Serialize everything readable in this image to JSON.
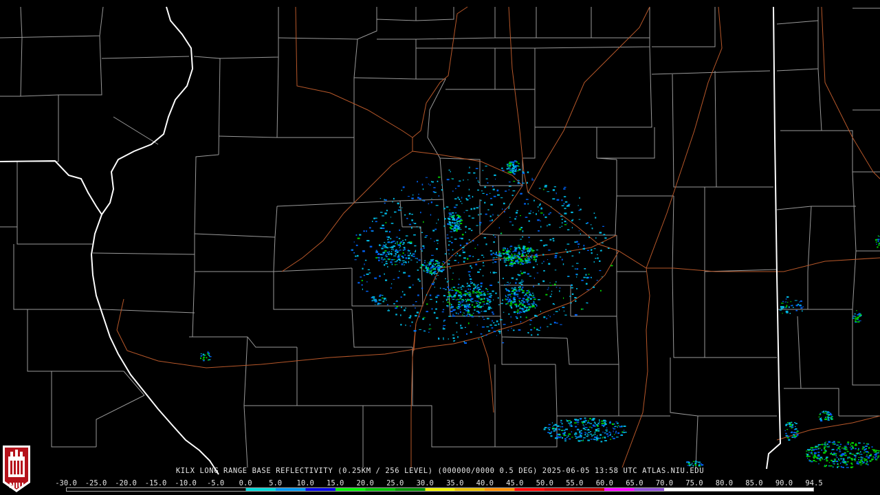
{
  "caption": "KILX LONG RANGE BASE REFLECTIVITY (0.25KM / 256 LEVEL) (000000/0000 0.5 DEG) 2025-06-05 13:58 UTC  ATLAS.NIU.EDU",
  "logo_text": "NIU",
  "scale": {
    "labels": [
      "-30.0",
      "-25.0",
      "-20.0",
      "-15.0",
      "-10.0",
      "-5.0",
      "0.0",
      "5.0",
      "10.0",
      "15.0",
      "20.0",
      "25.0",
      "30.0",
      "35.0",
      "40.0",
      "45.0",
      "50.0",
      "55.0",
      "60.0",
      "65.0",
      "70.0",
      "75.0",
      "80.0",
      "85.0",
      "90.0",
      "94.5"
    ],
    "colors": [
      "#000000",
      "#000000",
      "#000000",
      "#000000",
      "#000000",
      "#000000",
      "#00d8d8",
      "#0098f0",
      "#0000e8",
      "#00f000",
      "#00c000",
      "#009000",
      "#f0f000",
      "#e8c000",
      "#ff9000",
      "#ff0000",
      "#d80000",
      "#c00000",
      "#ff00ff",
      "#9050d8",
      "#ffffff",
      "#ffffff",
      "#ffffff",
      "#ffffff",
      "#ffffff"
    ]
  },
  "colors": {
    "county_border": "#9a9a9a",
    "state_border": "#ffffff",
    "highway": "#b8582a",
    "echo_light": "#00b8e0",
    "echo_mid": "#0060f0",
    "echo_strong": "#00d000"
  }
}
